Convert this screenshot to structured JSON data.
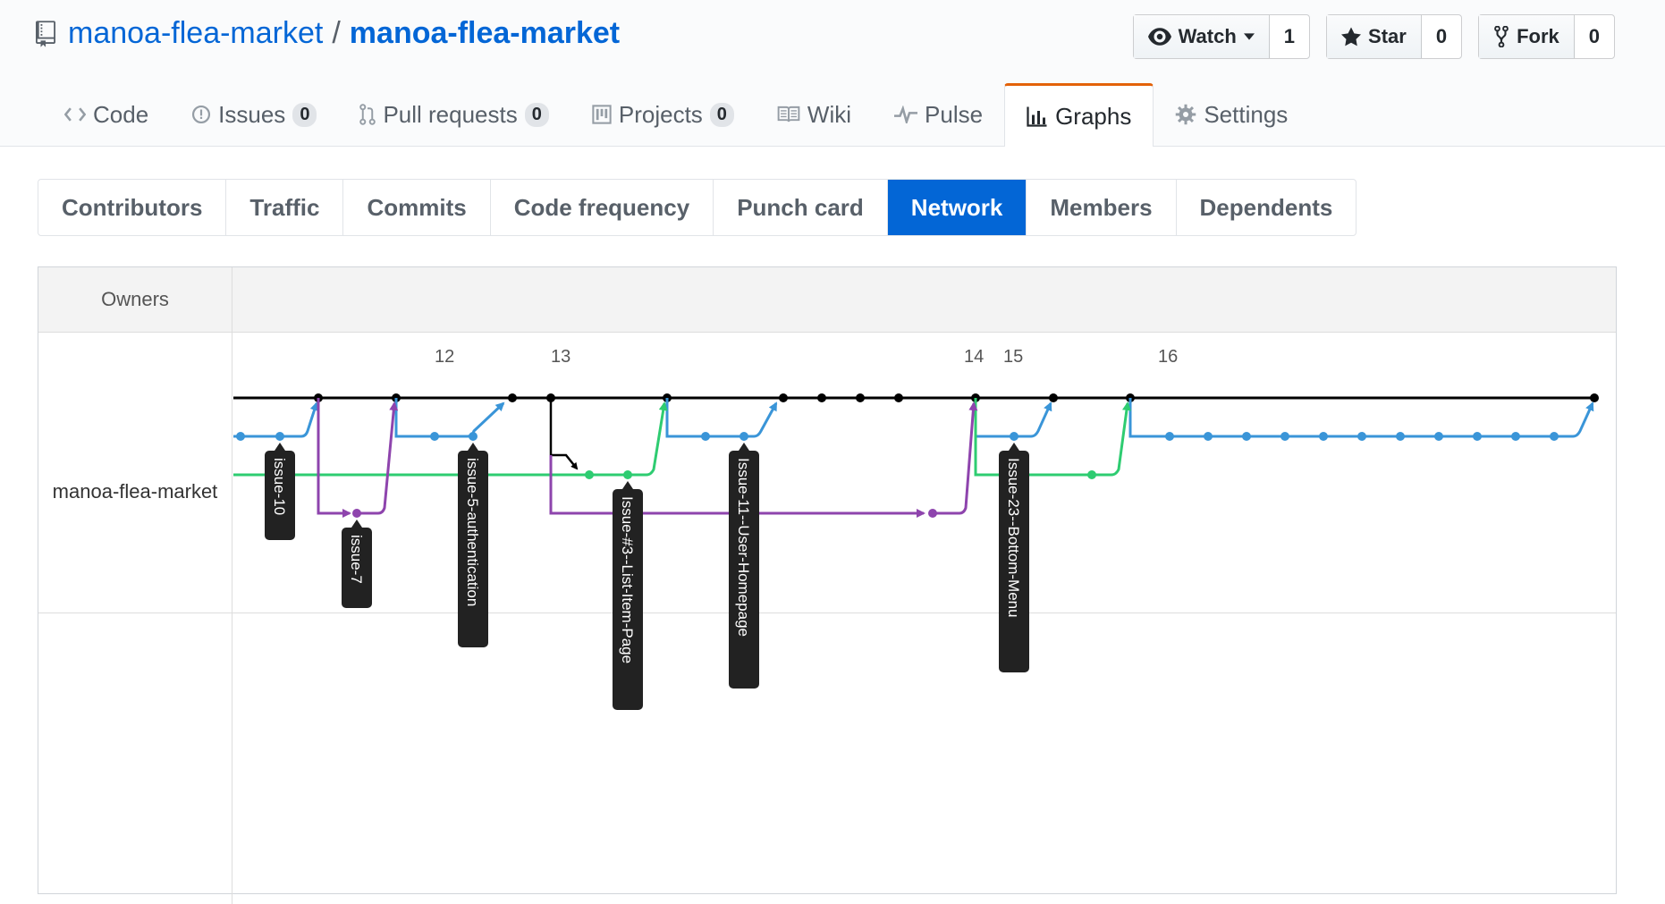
{
  "repo": {
    "owner": "manoa-flea-market",
    "separator": "/",
    "name": "manoa-flea-market"
  },
  "actions": {
    "watch": {
      "label": "Watch",
      "count": "1"
    },
    "star": {
      "label": "Star",
      "count": "0"
    },
    "fork": {
      "label": "Fork",
      "count": "0"
    }
  },
  "tabs": [
    {
      "label": "Code",
      "icon": "code-icon"
    },
    {
      "label": "Issues",
      "count": "0",
      "icon": "issue-icon"
    },
    {
      "label": "Pull requests",
      "count": "0",
      "icon": "pull-request-icon"
    },
    {
      "label": "Projects",
      "count": "0",
      "icon": "project-icon"
    },
    {
      "label": "Wiki",
      "icon": "book-icon"
    },
    {
      "label": "Pulse",
      "icon": "pulse-icon"
    },
    {
      "label": "Graphs",
      "icon": "graph-icon",
      "selected": true
    },
    {
      "label": "Settings",
      "icon": "gear-icon"
    }
  ],
  "subnav": [
    "Contributors",
    "Traffic",
    "Commits",
    "Code frequency",
    "Punch card",
    "Network",
    "Members",
    "Dependents"
  ],
  "subnav_selected": "Network",
  "network": {
    "owners_label": "Owners",
    "owner": "manoa-flea-market",
    "dates": [
      "12",
      "13",
      "14",
      "15",
      "16"
    ],
    "branch_labels": [
      "issue-10",
      "issue-7",
      "issue-5-authentication",
      "Issue-#3--List-Item-Page",
      "Issue-11--User-Homepage",
      "Issue-23--Bottom-Menu"
    ],
    "colors": {
      "master": "#000000",
      "blue": "#3a95d8",
      "green": "#2ecc71",
      "purple": "#8e44ad"
    }
  }
}
